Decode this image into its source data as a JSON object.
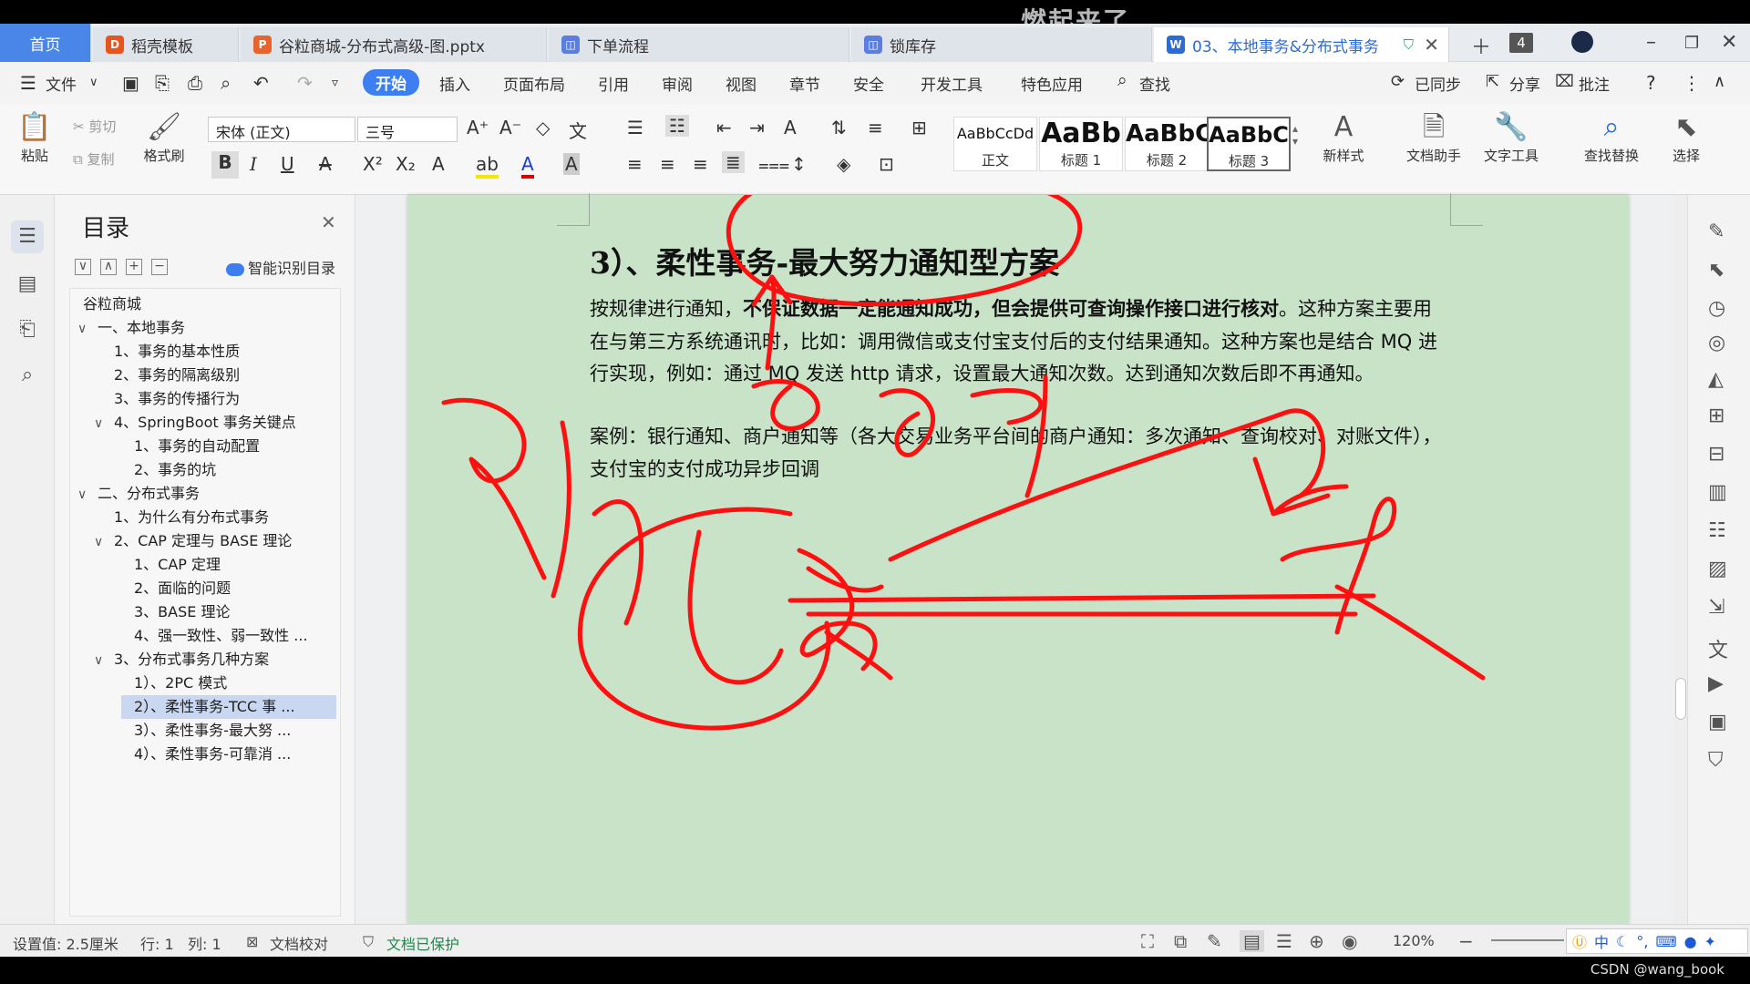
{
  "overlay": {
    "watermark": "燃起来了"
  },
  "tabs": [
    {
      "label": "首页"
    },
    {
      "label": "稻壳模板"
    },
    {
      "label": "谷粒商城-分布式高级-图.pptx"
    },
    {
      "label": "下单流程"
    },
    {
      "label": "锁库存"
    },
    {
      "label": "03、本地事务&分布式事务"
    }
  ],
  "tabbar": {
    "tab_count": "4"
  },
  "menu": {
    "file": "文件",
    "items": [
      "开始",
      "插入",
      "页面布局",
      "引用",
      "审阅",
      "视图",
      "章节",
      "安全",
      "开发工具",
      "特色应用"
    ],
    "search": "查找",
    "synced": "已同步",
    "share": "分享",
    "comment": "批注"
  },
  "ribbon": {
    "paste": "粘贴",
    "cut": "剪切",
    "copy": "复制",
    "format_painter": "格式刷",
    "font": "宋体 (正文)",
    "size": "三号",
    "styles": [
      {
        "sample": "AaBbCcDd",
        "name": "正文"
      },
      {
        "sample": "AaBb",
        "name": "标题 1"
      },
      {
        "sample": "AaBbC",
        "name": "标题 2"
      },
      {
        "sample": "AaBbC",
        "name": "标题 3"
      }
    ],
    "new_style": "新样式",
    "doc_assistant": "文档助手",
    "text_tools": "文字工具",
    "find_replace": "查找替换",
    "select": "选择"
  },
  "toc": {
    "title": "目录",
    "smart": "智能识别目录",
    "items": [
      {
        "label": "谷粒商城"
      },
      {
        "label": "一、本地事务"
      },
      {
        "label": "1、事务的基本性质"
      },
      {
        "label": "2、事务的隔离级别"
      },
      {
        "label": "3、事务的传播行为"
      },
      {
        "label": "4、SpringBoot 事务关键点"
      },
      {
        "label": "1、事务的自动配置"
      },
      {
        "label": "2、事务的坑"
      },
      {
        "label": "二、分布式事务"
      },
      {
        "label": "1、为什么有分布式事务"
      },
      {
        "label": "2、CAP 定理与 BASE 理论"
      },
      {
        "label": "1、CAP 定理"
      },
      {
        "label": "2、面临的问题"
      },
      {
        "label": "3、BASE 理论"
      },
      {
        "label": "4、强一致性、弱一致性 ..."
      },
      {
        "label": "3、分布式事务几种方案"
      },
      {
        "label": "1）、2PC 模式"
      },
      {
        "label": "2）、柔性事务-TCC 事 ..."
      },
      {
        "label": "3）、柔性事务-最大努 ..."
      },
      {
        "label": "4）、柔性事务-可靠消 ..."
      }
    ]
  },
  "document": {
    "heading": "3）、柔性事务-最大努力通知型方案",
    "p1_start": "按规律进行通知，",
    "p1_bold": "不保证数据一定能通知成功，但会提供可查询操作接口进行核对",
    "p1_end": "。这种方案主要用在与第三方系统通讯时，比如：调用微信或支付宝支付后的支付结果通知。这种方案也是结合 MQ 进行实现，例如：通过 MQ 发送 http 请求，设置最大通知次数。达到通知次数后即不再通知。",
    "p2": "案例：银行通知、商户通知等（各大交易业务平台间的商户通知：多次通知、查询校对、对账文件），支付宝的支付成功异步回调"
  },
  "status": {
    "setting": "设置值: 2.5厘米",
    "row": "行: 1",
    "col": "列: 1",
    "proof": "文档校对",
    "protect": "文档已保护",
    "zoom": "120%",
    "ime": "中"
  },
  "footer": {
    "credit": "CSDN @wang_book"
  },
  "colors": {
    "accent": "#3d7ff2",
    "page_bg": "#c8e3c7",
    "ink": "#ff0000"
  }
}
